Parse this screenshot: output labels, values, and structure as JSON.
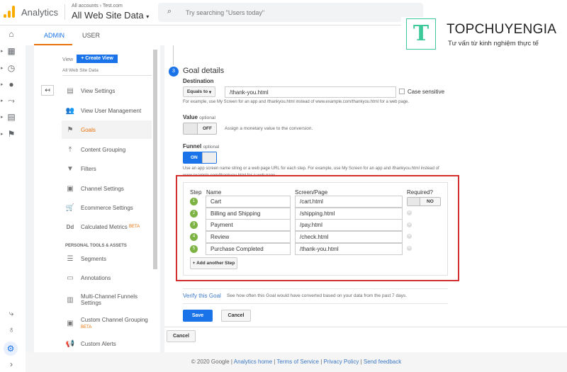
{
  "header": {
    "app_name": "Analytics",
    "breadcrumb": "All accounts",
    "breadcrumb_account": "Test.com",
    "view_name": "All Web Site Data",
    "search_placeholder": "Try searching \"Users today\""
  },
  "tabs": [
    {
      "label": "ADMIN",
      "active": true
    },
    {
      "label": "USER",
      "active": false
    }
  ],
  "view_column": {
    "label": "View",
    "create_button": "+ Create View",
    "view_name": "All Web Site Data"
  },
  "nav": [
    {
      "label": "View Settings",
      "icon": "document-icon"
    },
    {
      "label": "View User Management",
      "icon": "people-icon"
    },
    {
      "label": "Goals",
      "icon": "flag-icon",
      "active": true
    },
    {
      "label": "Content Grouping",
      "icon": "merge-icon"
    },
    {
      "label": "Filters",
      "icon": "filter-icon"
    },
    {
      "label": "Channel Settings",
      "icon": "channel-icon"
    },
    {
      "label": "Ecommerce Settings",
      "icon": "cart-icon"
    },
    {
      "label": "Calculated Metrics",
      "icon": "dd-icon",
      "badge": "BETA"
    }
  ],
  "personal_section": "PERSONAL TOOLS & ASSETS",
  "personal_nav": [
    {
      "label": "Segments",
      "icon": "segments-icon"
    },
    {
      "label": "Annotations",
      "icon": "comment-icon"
    },
    {
      "label": "Multi-Channel Funnels Settings",
      "icon": "bar-chart-icon"
    },
    {
      "label": "Custom Channel Grouping",
      "icon": "grouping-icon",
      "badge": "BETA"
    },
    {
      "label": "Custom Alerts",
      "icon": "megaphone-icon"
    }
  ],
  "goal": {
    "step_number": "3",
    "title": "Goal details",
    "destination_label": "Destination",
    "match_type": "Equals to",
    "destination_value": "/thank-you.html",
    "case_sensitive": "Case sensitive",
    "destination_help": "For example, use My Screen for an app and /thankyou.html instead of www.example.com/thankyou.html for a web page.",
    "value_label": "Value",
    "optional": "optional",
    "value_toggle": "OFF",
    "value_help": "Assign a monetary value to the conversion.",
    "funnel_label": "Funnel",
    "funnel_toggle": "ON",
    "funnel_help": "Use an app screen name string or a web page URL for each step. For example, use My Screen for an app and /thankyou.html instead of www.example.com/thankyou.html for a web page.",
    "columns": {
      "step": "Step",
      "name": "Name",
      "page": "Screen/Page",
      "required": "Required?"
    },
    "required_toggle": "NO",
    "steps": [
      {
        "n": "1",
        "name": "Cart",
        "page": "/cart.html"
      },
      {
        "n": "2",
        "name": "Billing and Shipping",
        "page": "/shipping.html"
      },
      {
        "n": "3",
        "name": "Payment",
        "page": "/pay.html"
      },
      {
        "n": "4",
        "name": "Review",
        "page": "/check.html"
      },
      {
        "n": "5",
        "name": "Purchase Completed",
        "page": "/thank-you.html"
      }
    ],
    "add_step": "+ Add another Step",
    "verify_link": "Verify this Goal",
    "verify_help": "See how often this Goal would have converted based on your data from the past 7 days.",
    "save": "Save",
    "cancel": "Cancel"
  },
  "outer_cancel": "Cancel",
  "footer": {
    "copyright": "© 2020 Google |",
    "links": [
      "Analytics home",
      "Terms of Service",
      "Privacy Policy",
      "Send feedback"
    ]
  },
  "watermark": {
    "letter": "T",
    "brand": "TOPCHUYENGIA",
    "tagline": "Tư vấn từ kinh nghiệm thực tế"
  },
  "colors": {
    "accent": "#1a73e8",
    "highlight": "#d32f2f",
    "step_green": "#7cb342",
    "tab_underline": "#e8710a"
  }
}
